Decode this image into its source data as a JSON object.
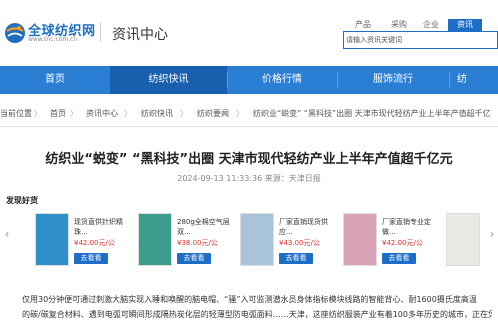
{
  "header": {
    "logo_text": "全球纺织网",
    "logo_url": "www.tnc.com.cn",
    "section_title": "资讯中心",
    "search_tabs": [
      "产品",
      "采购",
      "企业",
      "资讯"
    ],
    "search_placeholder": "请输入资讯关键词"
  },
  "nav": {
    "items": [
      "首页",
      "纺织快讯",
      "价格行情",
      "服饰流行",
      "纺"
    ]
  },
  "breadcrumb": {
    "items": [
      "当前位置",
      "首页",
      "资讯中心",
      "纺织快讯",
      "纺织要闻",
      "纺织业“蜕变” “黑科技”出圈  天津市现代轻纺产业上半年产值超千亿"
    ]
  },
  "article": {
    "title": "纺织业“蜕变” “黑科技”出圈  天津市现代轻纺产业上半年产值超千亿元",
    "meta": "2024-09-13 11:33:36 来源：天津日报",
    "paragraph_lines": [
      "仅用30分钟便可通过刺激大脑实现入睡和唤醒的脑电帽、“骚”入可监测潜水员身体指标模块线路的智能背心、耐1600摄氏度高温",
      "的碳/碳复合材料、遇到电弧可瞬间形成隔热炭化层的轻薄型防电弧面料……天津，这座纺织服装产业有着100多年历史的城市，正在凭借"
    ]
  },
  "products": {
    "section_label": "发现好货",
    "button_label": "去看看",
    "items": [
      {
        "name": "现货直供针织精珠...",
        "price": "¥42.00元/公",
        "color": "#2f8fc9"
      },
      {
        "name": "280g全棉空气层双...",
        "price": "¥38.00元/公",
        "color": "#3b9d8b"
      },
      {
        "name": "厂家直销现货供应...",
        "price": "¥43.00元/公",
        "color": "#a9c3dd"
      },
      {
        "name": "厂家直销专业定做...",
        "price": "¥42.00元/公",
        "color": "#d9a3b7"
      },
      {
        "name": "",
        "price": "",
        "color": "#e9e9e6"
      }
    ]
  }
}
